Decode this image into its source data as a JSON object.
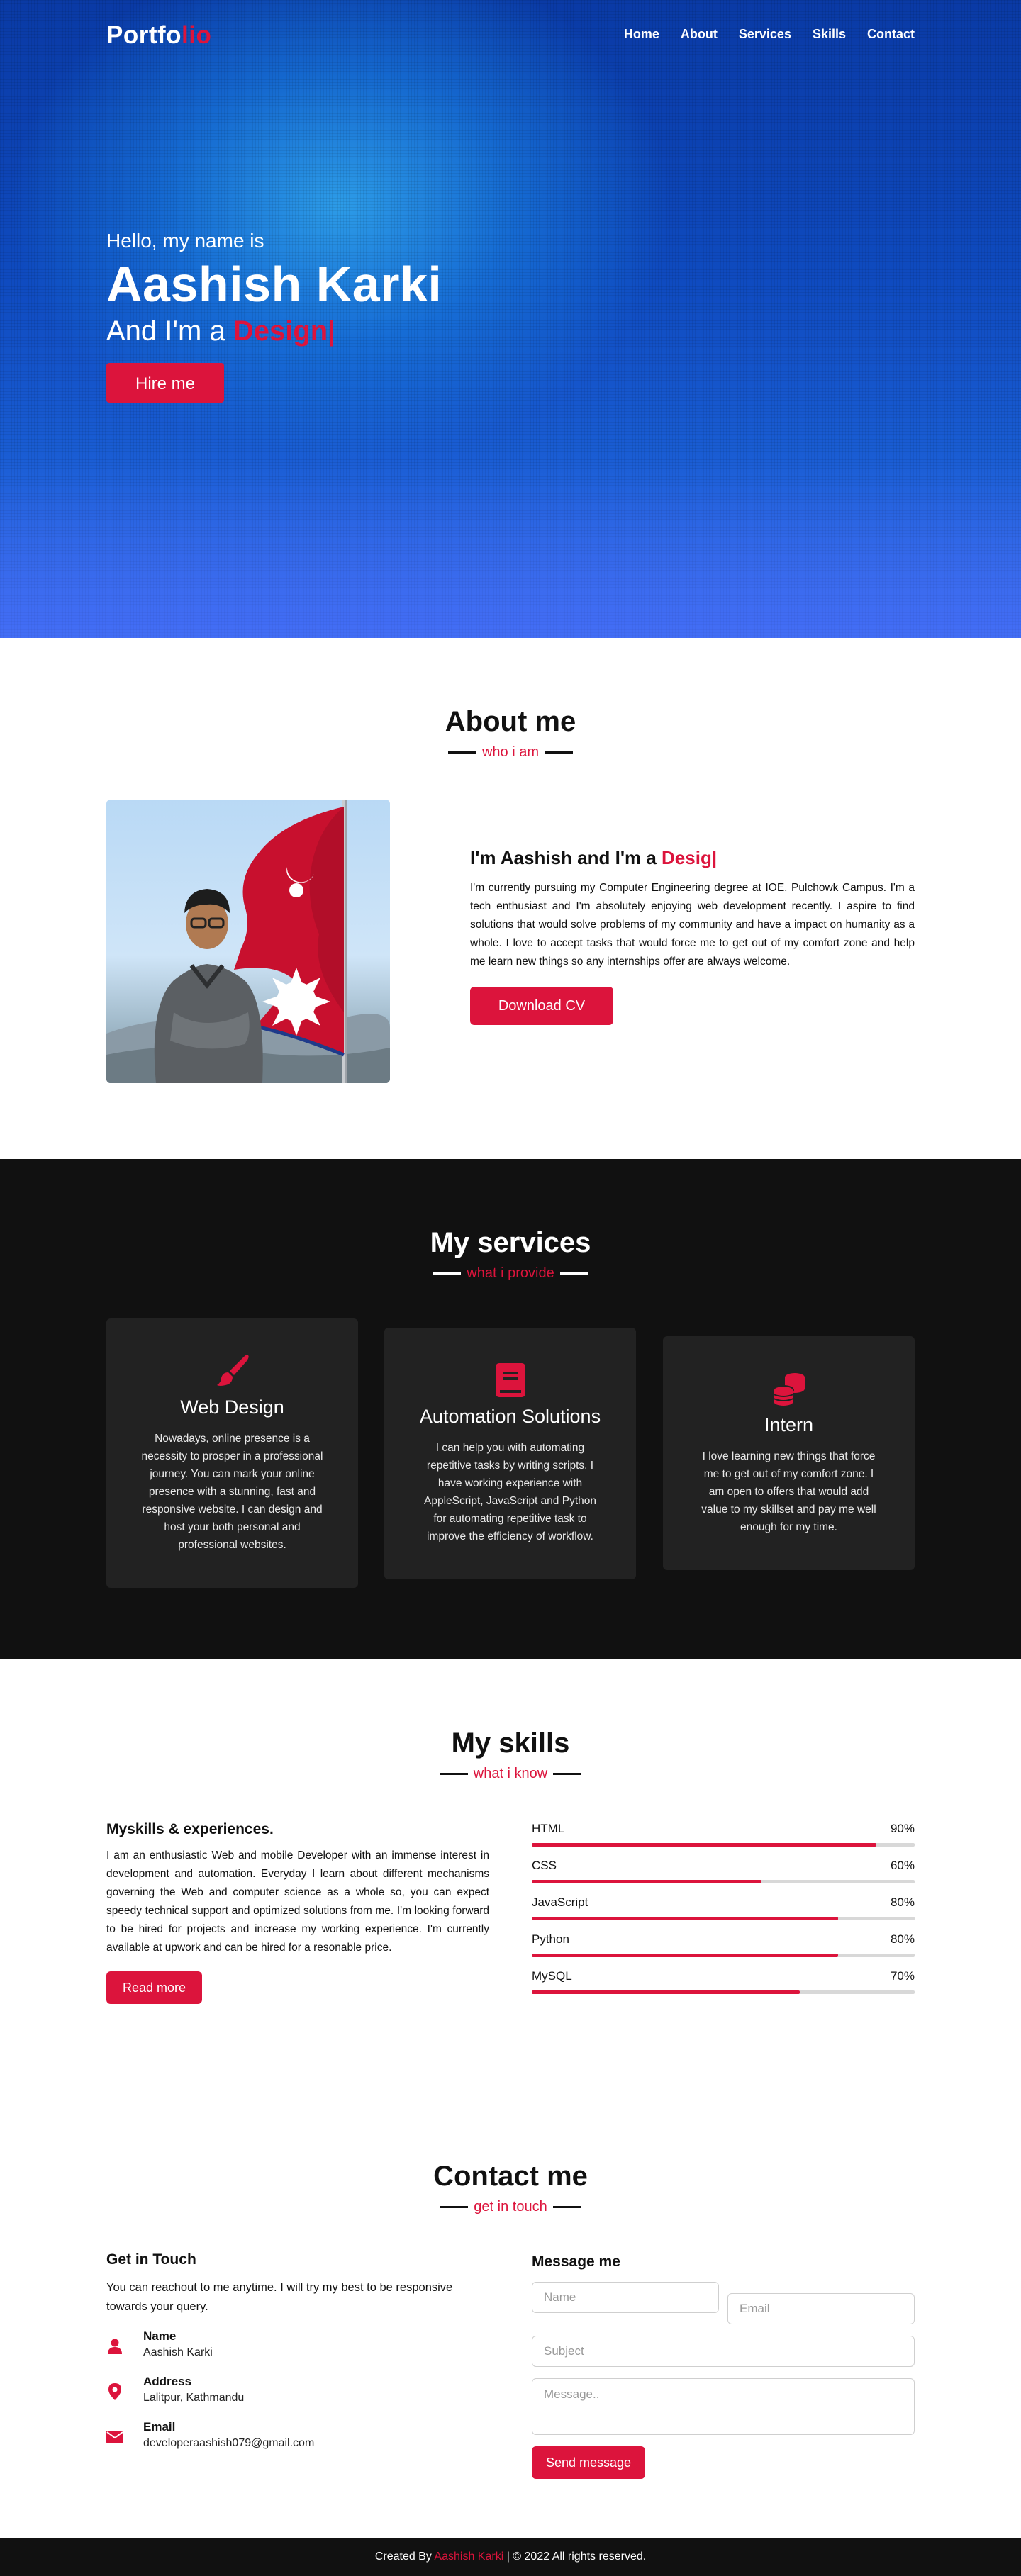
{
  "colors": {
    "accent": "#dc143c",
    "dark": "#111111",
    "card": "#222222"
  },
  "nav": {
    "logo_main": "Portfo",
    "logo_accent": "lio",
    "items": [
      "Home",
      "About",
      "Services",
      "Skills",
      "Contact"
    ]
  },
  "hero": {
    "greeting": "Hello, my name is",
    "name": "Aashish Karki",
    "role_prefix": "And I'm a ",
    "role_typed": "Design",
    "cursor": "|",
    "cta": "Hire me"
  },
  "about": {
    "title": "About me",
    "subtitle": "who i am",
    "heading_prefix": "I'm Aashish and I'm a ",
    "heading_typed": "Desig",
    "cursor": "|",
    "paragraph": "I'm currently pursuing my Computer Engineering degree at IOE, Pulchowk Campus. I'm a tech enthusiast and I'm absolutely enjoying web development recently. I aspire to find solutions that would solve problems of my community and have a impact on humanity as a whole. I love to accept tasks that would force me to get out of my comfort zone and help me learn new things so any internships offer are always welcome.",
    "cta": "Download CV"
  },
  "services": {
    "title": "My services",
    "subtitle": "what i provide",
    "cards": [
      {
        "icon": "paint-brush-icon",
        "title": "Web Design",
        "text": "Nowadays, online presence is a necessity to prosper in a professional journey. You can mark your online presence with a stunning, fast and responsive website. I can design and host your both personal and professional websites."
      },
      {
        "icon": "book-icon",
        "title": "Automation Solutions",
        "text": "I can help you with automating repetitive tasks by writing scripts. I have working experience with AppleScript, JavaScript and Python for automating repetitive task to improve the efficiency of workflow."
      },
      {
        "icon": "coins-icon",
        "title": "Intern",
        "text": "I love learning new things that force me to get out of my comfort zone. I am open to offers that would add value to my skillset and pay me well enough for my time."
      }
    ]
  },
  "skills": {
    "title": "My skills",
    "subtitle": "what i know",
    "heading": "Myskills & experiences.",
    "paragraph": "I am an enthusiastic Web and mobile Developer with an immense interest in development and automation. Everyday I learn about different mechanisms governing the Web and computer science as a whole so, you can expect speedy technical support and optimized solutions from me. I'm looking forward to be hired for projects and increase my working experience. I'm currently available at upwork and can be hired for a resonable price.",
    "cta": "Read more",
    "bars": [
      {
        "name": "HTML",
        "percent_label": "90%",
        "value": 90
      },
      {
        "name": "CSS",
        "percent_label": "60%",
        "value": 60
      },
      {
        "name": "JavaScript",
        "percent_label": "80%",
        "value": 80
      },
      {
        "name": "Python",
        "percent_label": "80%",
        "value": 80
      },
      {
        "name": "MySQL",
        "percent_label": "70%",
        "value": 70
      }
    ]
  },
  "contact": {
    "title": "Contact me",
    "subtitle": "get in touch",
    "left_heading": "Get in Touch",
    "left_text": "You can reachout to me anytime. I will try my best to be responsive towards your query.",
    "rows": [
      {
        "icon": "user-icon",
        "label": "Name",
        "value": "Aashish Karki"
      },
      {
        "icon": "map-marker-icon",
        "label": "Address",
        "value": "Lalitpur, Kathmandu"
      },
      {
        "icon": "envelope-icon",
        "label": "Email",
        "value": "developeraashish079@gmail.com"
      }
    ],
    "right_heading": "Message me",
    "placeholders": {
      "name": "Name",
      "email": "Email",
      "subject": "Subject",
      "message": "Message.."
    },
    "send": "Send message"
  },
  "footer": {
    "prefix": "Created By ",
    "author": "Aashish Karki",
    "suffix": " | © 2022 All rights reserved."
  }
}
